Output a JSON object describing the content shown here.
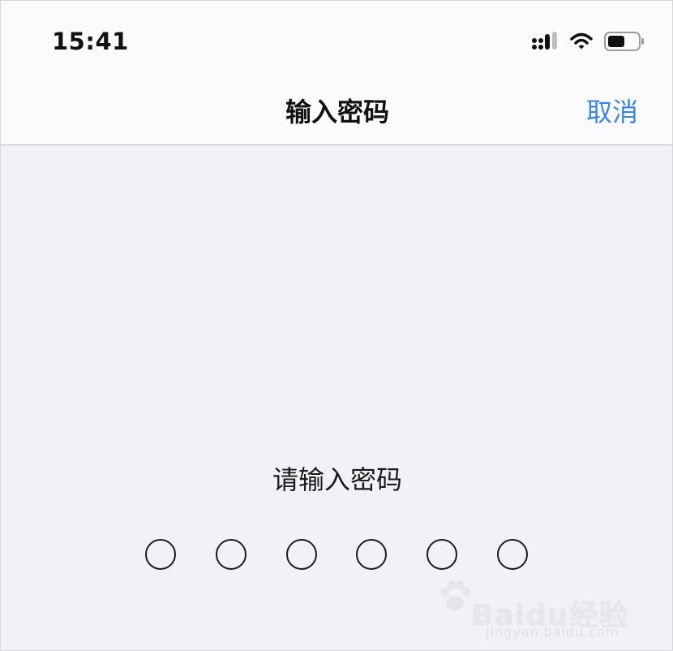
{
  "status_bar": {
    "time": "15:41",
    "icons": [
      "signal-icon",
      "wifi-icon",
      "battery-icon"
    ]
  },
  "nav": {
    "title": "输入密码",
    "cancel_label": "取消"
  },
  "body": {
    "prompt": "请输入密码",
    "passcode_length": 6,
    "entered_digits": 0
  },
  "watermark": {
    "brand": "Baidu经验",
    "sub": "jingyan.baidu.com"
  },
  "colors": {
    "accent": "#3a86e6",
    "background": "#f1f1f6",
    "nav_background": "#fbfbfd"
  }
}
